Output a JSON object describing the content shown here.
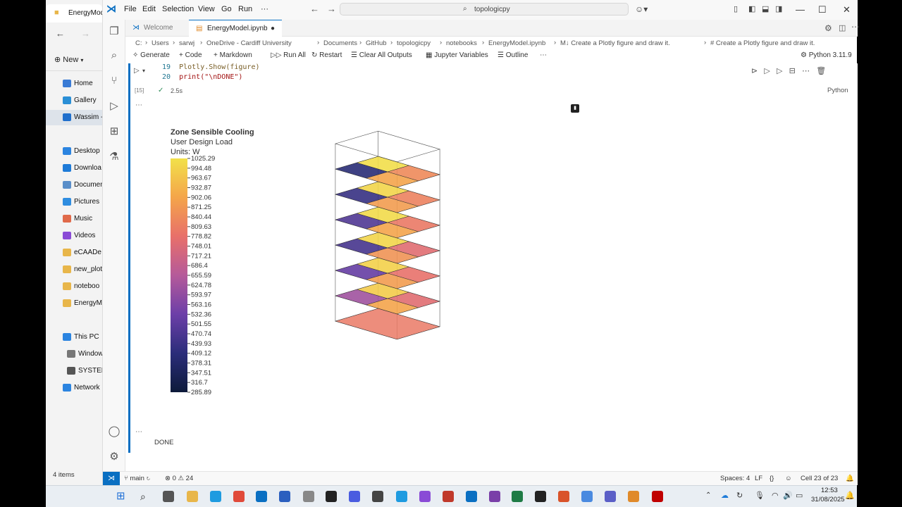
{
  "explorer": {
    "tab_title": "EnergyMod",
    "new_label": "New",
    "items": [
      {
        "label": "Home",
        "color": "#3a7bd5"
      },
      {
        "label": "Gallery",
        "color": "#2a8fd6"
      },
      {
        "label": "Wassim -",
        "color": "#1f6fcc"
      },
      {
        "label": "Desktop",
        "color": "#2b84e0"
      },
      {
        "label": "Downloa",
        "color": "#1e7bd8"
      },
      {
        "label": "Documen",
        "color": "#5a8ec9"
      },
      {
        "label": "Pictures",
        "color": "#2f8de0"
      },
      {
        "label": "Music",
        "color": "#e06a4a"
      },
      {
        "label": "Videos",
        "color": "#8a4bd6"
      },
      {
        "label": "eCAADe",
        "color": "#e8b64a"
      },
      {
        "label": "new_plot",
        "color": "#e8b64a"
      },
      {
        "label": "noteboo",
        "color": "#e8b64a"
      },
      {
        "label": "EnergyMo",
        "color": "#e8b64a"
      },
      {
        "label": "This PC",
        "color": "#2b84e0"
      },
      {
        "label": "Window",
        "color": "#777777"
      },
      {
        "label": "SYSTEM",
        "color": "#555555"
      },
      {
        "label": "Network",
        "color": "#2b84e0"
      }
    ],
    "status": "4 items"
  },
  "titlebar": {
    "menus": [
      "File",
      "Edit",
      "Selection",
      "View",
      "Go",
      "Run",
      "···"
    ],
    "search": "topologicpy"
  },
  "tabs": [
    {
      "label": "Welcome",
      "active": false
    },
    {
      "label": "EnergyModel.ipynb",
      "active": true
    }
  ],
  "breadcrumb": [
    "C:",
    "Users",
    "sarwj",
    "OneDrive - Cardiff University",
    "Documents",
    "GitHub",
    "topologicpy",
    "notebooks",
    "EnergyModel.ipynb",
    "M↓ Create a Plotly figure and draw it.",
    "# Create a Plotly figure and draw it."
  ],
  "toolbar": {
    "generate": "Generate",
    "code": "Code",
    "markdown": "Markdown",
    "run_all": "Run All",
    "restart": "Restart",
    "clear": "Clear All Outputs",
    "variables": "Jupyter Variables",
    "outline": "Outline",
    "kernel": "Python 3.11.9"
  },
  "cell": {
    "lines": [
      {
        "num": "19",
        "code": "Plotly.Show(figure)"
      },
      {
        "num": "20",
        "code": "print(\"\\nDONE\")"
      }
    ],
    "exec_count": "[15]",
    "time": "2.5s",
    "language": "Python",
    "output_text": "DONE"
  },
  "chart_data": {
    "type": "3d-mesh",
    "title": "Zone Sensible Cooling",
    "subtitle": "User Design Load",
    "units": "Units: W",
    "colorscale": [
      "#0d1a3a",
      "#2b2d7a",
      "#6c3fa8",
      "#b55a9a",
      "#e8706a",
      "#f4a54a",
      "#f2e14a"
    ],
    "colorbar_ticks": [
      1025.29,
      994.48,
      963.67,
      932.87,
      902.06,
      871.25,
      840.44,
      809.63,
      778.82,
      748.01,
      717.21,
      686.4,
      655.59,
      624.78,
      593.97,
      563.16,
      532.36,
      501.55,
      470.74,
      439.93,
      409.12,
      378.31,
      347.51,
      316.7,
      285.89
    ],
    "range": [
      285.89,
      1025.29
    ]
  },
  "statusbar": {
    "branch": "main",
    "problems": "⊗ 0 ⚠ 24",
    "spaces": "Spaces: 4",
    "eol": "LF",
    "braces": "{}",
    "cell": "Cell 23 of 23"
  },
  "taskbar": {
    "time": "12:53",
    "date": "31/08/2025"
  }
}
